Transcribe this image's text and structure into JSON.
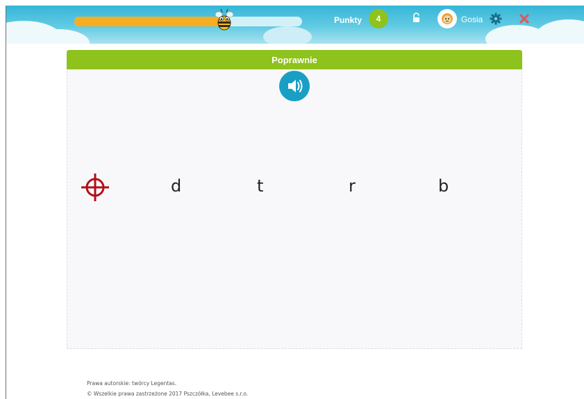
{
  "header": {
    "progress_fraction": 0.67,
    "points_label": "Punkty",
    "points_value": "4",
    "username": "Gosia",
    "icons": [
      "bee-icon",
      "lock-icon",
      "avatar-icon",
      "gear-icon",
      "close-icon"
    ],
    "colors": {
      "progress": "#f6ad21",
      "points_badge": "#8fc21b",
      "close": "#e8545e"
    }
  },
  "exercise": {
    "status_title": "Poprawnie",
    "status_color": "#8ec21c",
    "sound_icon": "speaker-icon",
    "target_icon": "crosshair-icon",
    "letters": [
      "d",
      "t",
      "r",
      "b"
    ]
  },
  "footer": {
    "line1": "Prawa autorskie: twórcy Legentas.",
    "line2": "© Wszelkie prawa zastrzeżone 2017 Pszczółka, Levebee s.r.o."
  }
}
